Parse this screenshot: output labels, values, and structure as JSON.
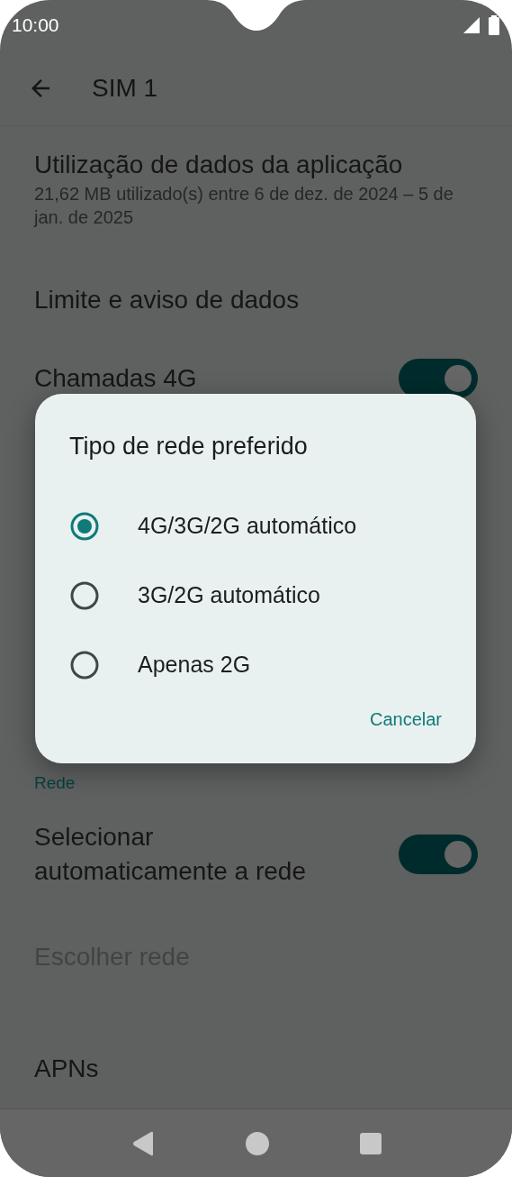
{
  "status_bar": {
    "time": "10:00"
  },
  "app_bar": {
    "title": "SIM 1"
  },
  "settings": [
    {
      "kind": "item",
      "title": "Utilização de dados da aplicação",
      "subtitle": "21,62 MB utilizado(s) entre 6 de dez. de 2024 – 5 de jan. de 2025",
      "disabled": false
    },
    {
      "kind": "item",
      "title": "Limite e aviso de dados",
      "disabled": false
    },
    {
      "kind": "toggle",
      "title": "Chamadas 4G",
      "on": true,
      "disabled": false
    },
    {
      "kind": "header",
      "title": "Rede"
    },
    {
      "kind": "toggle",
      "title": "Selecionar automaticamente a rede",
      "on": true,
      "disabled": false
    },
    {
      "kind": "item",
      "title": "Escolher rede",
      "disabled": true
    },
    {
      "kind": "item",
      "title": "APNs",
      "disabled": false
    }
  ],
  "dialog": {
    "title": "Tipo de rede preferido",
    "options": [
      {
        "label": "4G/3G/2G automático",
        "selected": true
      },
      {
        "label": "3G/2G automático",
        "selected": false
      },
      {
        "label": "Apenas 2G",
        "selected": false
      }
    ],
    "buttons": [
      "Cancelar"
    ]
  }
}
